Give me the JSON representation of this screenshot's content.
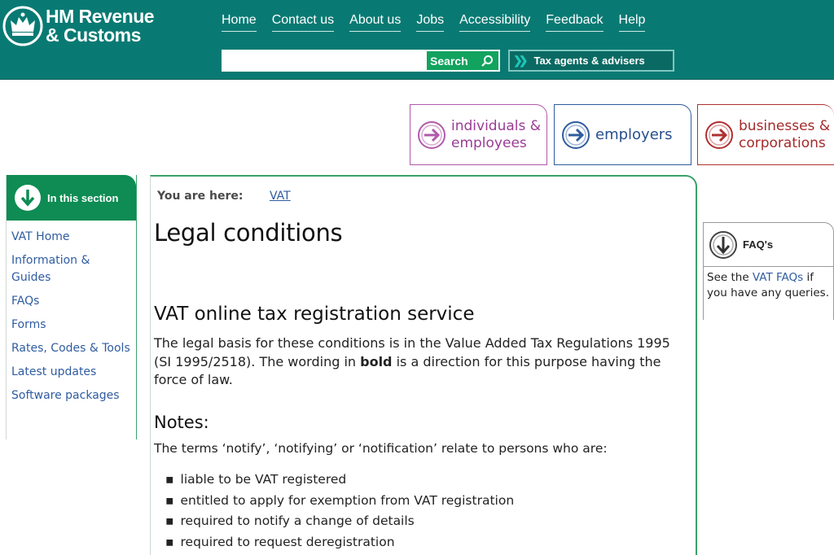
{
  "header": {
    "logo_line1": "HM Revenue",
    "logo_line2": "& Customs",
    "nav": [
      "Home",
      "Contact us",
      "About us",
      "Jobs",
      "Accessibility",
      "Feedback",
      "Help"
    ],
    "search": {
      "value": "",
      "button_label": "Search"
    },
    "agents_button": "Tax agents & advisers",
    "colors": {
      "header_bg": "#097a73",
      "search_btn": "#12a35f"
    }
  },
  "audience_tabs": {
    "individuals": [
      "individuals &",
      "employees"
    ],
    "employers": "employers",
    "businesses": [
      "businesses &",
      "corporations"
    ]
  },
  "left_nav": {
    "title": "In this section",
    "items": [
      "VAT Home",
      "Information & Guides",
      "FAQs",
      "Forms",
      "Rates, Codes & Tools",
      "Latest updates",
      "Software packages"
    ]
  },
  "breadcrumb": {
    "label": "You are here:",
    "link": "VAT"
  },
  "content": {
    "title": "Legal conditions",
    "section_title": "VAT online tax registration service",
    "intro_before": "The legal basis for these conditions is in the Value Added Tax Regulations 1995 (SI 1995/2518). The wording in ",
    "intro_bold": "bold",
    "intro_after": " is a direction for this purpose having the force of law.",
    "notes_title": "Notes:",
    "notes_intro": "The terms ‘notify’, ‘notifying’ or ‘notification’ relate to persons who are:",
    "bullets": [
      "liable to be VAT registered",
      "entitled to apply for exemption from VAT registration",
      "required to notify a change of details",
      "required to request deregistration"
    ]
  },
  "faq": {
    "title": "FAQ's",
    "before": "See the ",
    "link": "VAT FAQs",
    "after": " if you have any queries."
  }
}
